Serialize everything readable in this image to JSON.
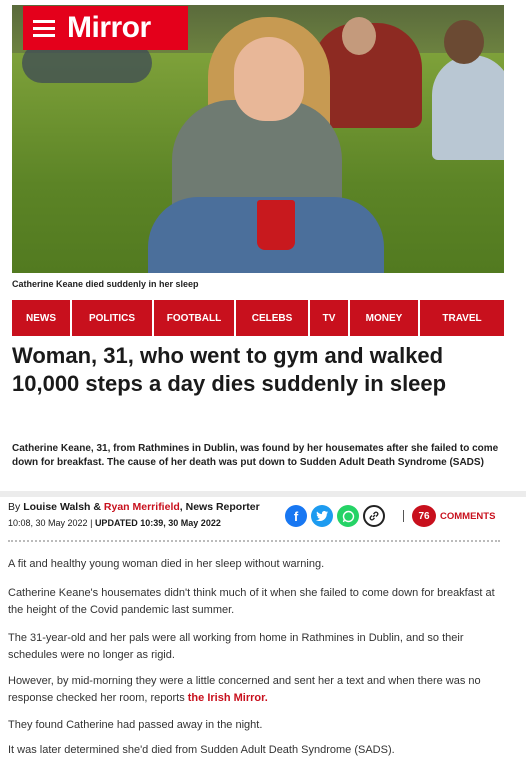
{
  "brand": {
    "name": "Mirror",
    "color": "#e4001b"
  },
  "hero": {
    "caption": "Catherine Keane died suddenly in her sleep"
  },
  "nav": {
    "items": [
      "NEWS",
      "POLITICS",
      "FOOTBALL",
      "CELEBS",
      "TV",
      "MONEY",
      "TRAVEL"
    ]
  },
  "article": {
    "headline": "Woman, 31, who went to gym and walked 10,000 steps a day dies suddenly in sleep",
    "standfirst": "Catherine Keane, 31, from Rathmines in Dublin, was found by her housemates after she failed to come down for breakfast. The cause of her death was put down to Sudden Adult Death Syndrome (SADS)",
    "byline": {
      "prefix": "By",
      "author1": "Louise Walsh",
      "joiner": "&",
      "author2": "Ryan Merrifield",
      "role": ", News Reporter"
    },
    "published": "10:08, 30 May 2022",
    "separator": "|",
    "updated": "UPDATED 10:39, 30 May 2022",
    "share_icons": [
      "facebook-icon",
      "twitter-icon",
      "whatsapp-icon",
      "link-icon"
    ],
    "comments": {
      "count": "76",
      "label": "COMMENTS"
    },
    "paragraphs": [
      "A fit and healthy young woman died in her sleep without warning.",
      "Catherine Keane's housemates didn't think much of it when she failed to come down for breakfast at the height of the Covid pandemic last summer.",
      "The 31-year-old and her pals were all working from home in Rathmines in Dublin, and so their schedules were no longer as rigid.",
      "However, by mid-morning they were a little concerned and sent her a text and when there was no response checked her room, reports",
      "They found Catherine had passed away in the night.",
      "It was later determined she'd died from Sudden Adult Death Syndrome (SADS)."
    ],
    "inline_link": "the Irish Mirror."
  }
}
